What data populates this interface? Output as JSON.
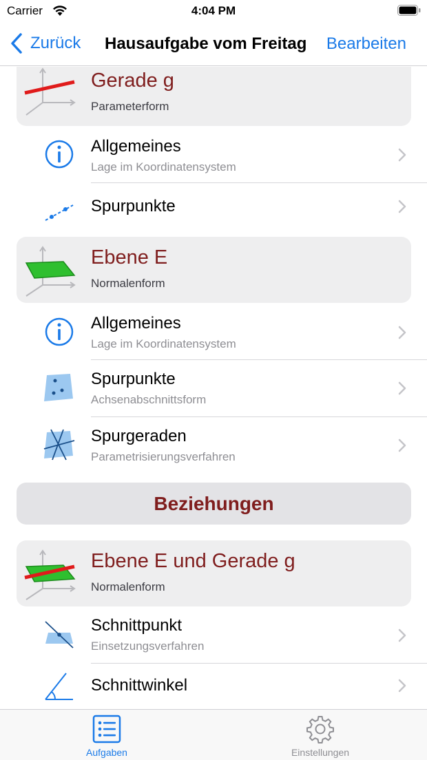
{
  "status_bar": {
    "carrier": "Carrier",
    "time": "4:04 PM"
  },
  "nav": {
    "back_label": "Zurück",
    "title": "Hausaufgabe vom Freitag",
    "edit_label": "Bearbeiten"
  },
  "sections": {
    "gerade": {
      "title": "Gerade g",
      "subtitle": "Parameterform",
      "rows": [
        {
          "title": "Allgemeines",
          "subtitle": "Lage im Koordinatensystem",
          "icon": "info-icon"
        },
        {
          "title": "Spurpunkte",
          "icon": "trace-points-line-icon"
        }
      ]
    },
    "ebene": {
      "title": "Ebene E",
      "subtitle": "Normalenform",
      "rows": [
        {
          "title": "Allgemeines",
          "subtitle": "Lage im Koordinatensystem",
          "icon": "info-icon"
        },
        {
          "title": "Spurpunkte",
          "subtitle": "Achsenabschnittsform",
          "icon": "trace-points-plane-icon"
        },
        {
          "title": "Spurgeraden",
          "subtitle": "Parametrisierungsverfahren",
          "icon": "trace-lines-icon"
        }
      ]
    },
    "beziehungen": {
      "label": "Beziehungen"
    },
    "ebene_gerade": {
      "title": "Ebene E und Gerade g",
      "subtitle": "Normalenform",
      "rows": [
        {
          "title": "Schnittpunkt",
          "subtitle": "Einsetzungsverfahren",
          "icon": "intersection-point-icon"
        },
        {
          "title": "Schnittwinkel",
          "icon": "intersection-angle-icon"
        }
      ]
    }
  },
  "tabs": [
    {
      "label": "Aufgaben",
      "icon": "list-icon",
      "active": true
    },
    {
      "label": "Einstellungen",
      "icon": "gear-icon",
      "active": false
    }
  ],
  "colors": {
    "accent": "#1a7ae8",
    "section_title": "#7f1d1d",
    "plane_green": "#2fbf2f",
    "line_red": "#e01b1b"
  }
}
